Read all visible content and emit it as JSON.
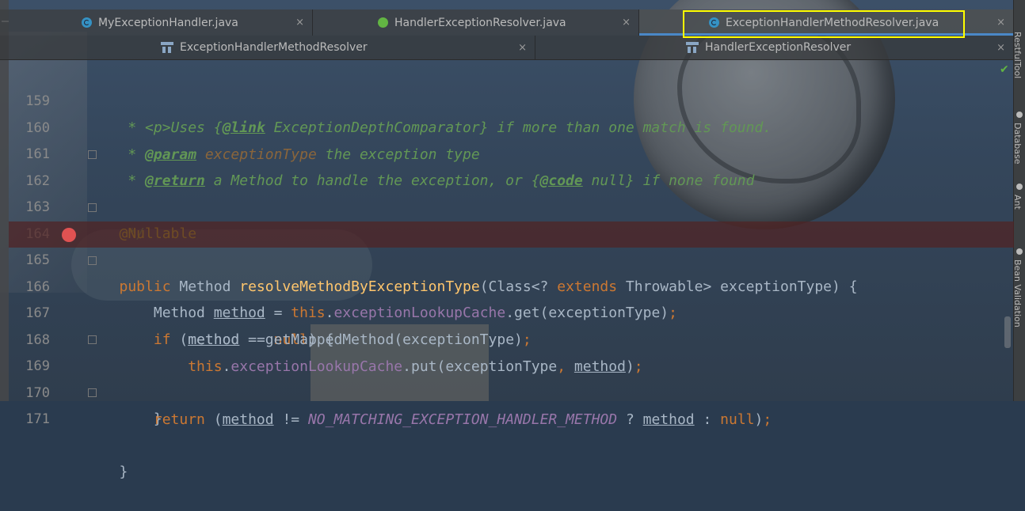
{
  "tabs_top": [
    {
      "label": "MyExceptionHandler.java",
      "icon": "class-c-icon"
    },
    {
      "label": "HandlerExceptionResolver.java",
      "icon": "interface-i-icon"
    },
    {
      "label": "ExceptionHandlerMethodResolver.java",
      "icon": "class-c-icon",
      "active": true
    }
  ],
  "tabs_second": [
    {
      "label": "ExceptionHandlerMethodResolver",
      "icon": "structure-icon"
    },
    {
      "label": "HandlerExceptionResolver",
      "icon": "structure-icon"
    }
  ],
  "close_glyph": "×",
  "right_sidebar": [
    "RestfulTool",
    "Database",
    "Ant",
    "Bean Validation"
  ],
  "gutter_breakpoint_line": 165,
  "code_lines": [
    {
      "num": "159",
      "text": " * <p>Uses {@link ExceptionDepthComparator} if more than one match is found."
    },
    {
      "num": "160",
      "text": " * @param exceptionType the exception type"
    },
    {
      "num": "161",
      "text": " * @return a Method to handle the exception, or {@code null} if none found"
    },
    {
      "num": "162",
      "text": " */"
    },
    {
      "num": "163",
      "text": "@Nullable"
    },
    {
      "num": "164",
      "text": "public Method resolveMethodByExceptionType(Class<? extends Throwable> exceptionType) {"
    },
    {
      "num": "165",
      "text": "    Method method = this.exceptionLookupCache.get(exceptionType);"
    },
    {
      "num": "166",
      "text": "    if (method == null) {"
    },
    {
      "num": "167",
      "text": "        method = getMappedMethod(exceptionType);"
    },
    {
      "num": "168",
      "text": "        this.exceptionLookupCache.put(exceptionType, method);"
    },
    {
      "num": "169",
      "text": "    }"
    },
    {
      "num": "170",
      "text": "    return (method != NO_MATCHING_EXCEPTION_HANDLER_METHOD ? method : null);"
    },
    {
      "num": "171",
      "text": "}"
    }
  ],
  "colors": {
    "keyword": "#cc7832",
    "annotation": "#bbb529",
    "method_decl": "#ffc66d",
    "field": "#9876aa",
    "comment": "#629755",
    "breakpoint": "#e05252",
    "highlight_box": "#ffff00"
  }
}
